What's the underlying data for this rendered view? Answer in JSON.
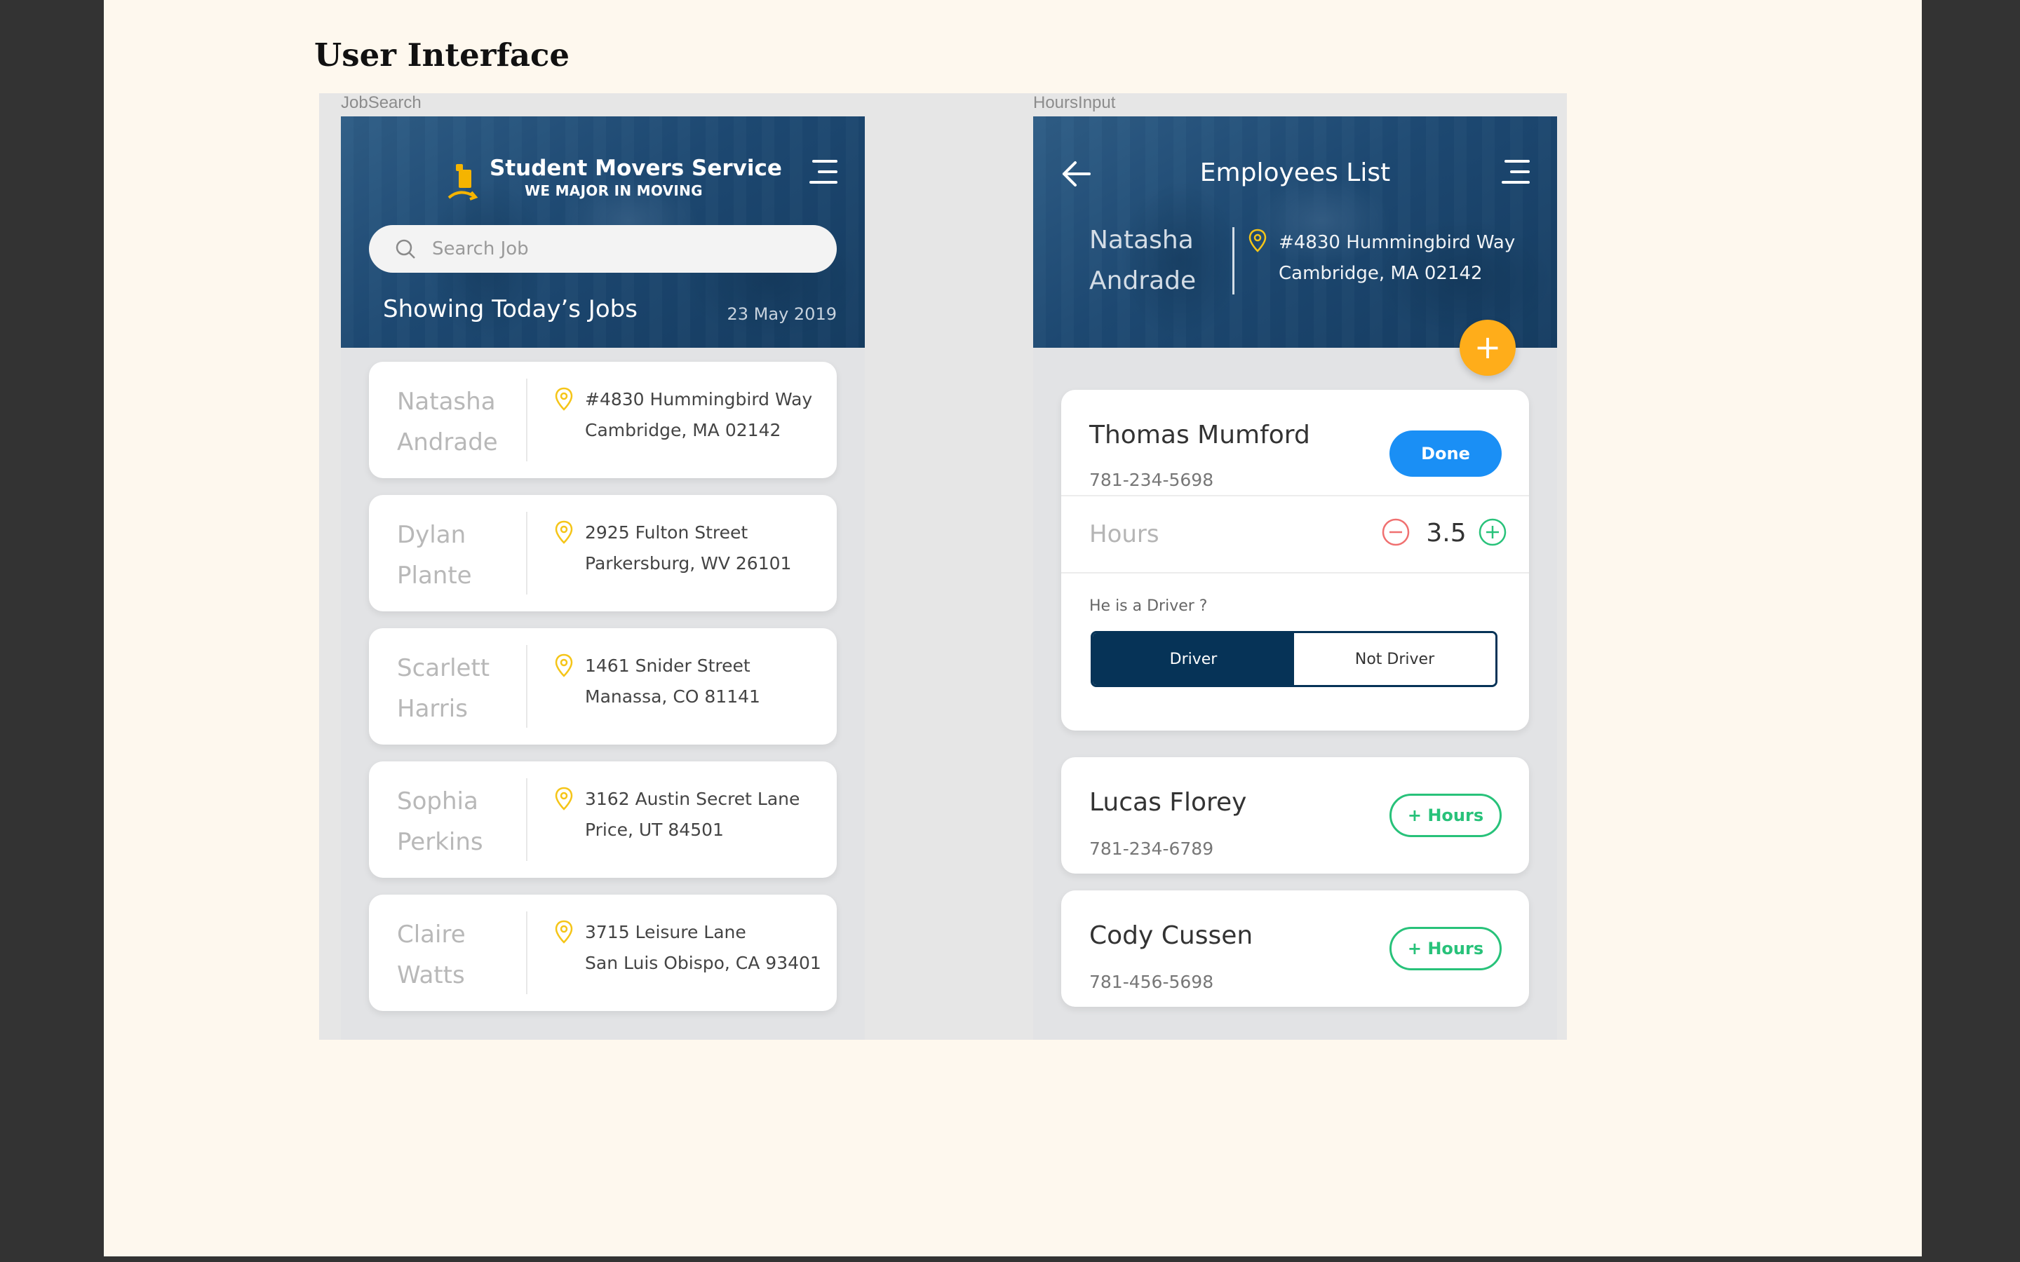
{
  "document": {
    "title": "User Interface"
  },
  "frames": {
    "left_label": "JobSearch",
    "right_label": "HoursInput"
  },
  "job_search": {
    "brand_name": "Student Movers Service",
    "brand_tagline": "WE MAJOR IN MOVING",
    "search_placeholder": "Search Job",
    "showing_label": "Showing Today’s Jobs",
    "date": "23 May 2019",
    "jobs": [
      {
        "first": "Natasha",
        "last": "Andrade",
        "addr1": "#4830 Hummingbird Way",
        "addr2": "Cambridge, MA 02142"
      },
      {
        "first": "Dylan",
        "last": "Plante",
        "addr1": "2925 Fulton Street",
        "addr2": "Parkersburg, WV 26101"
      },
      {
        "first": "Scarlett",
        "last": "Harris",
        "addr1": "1461 Snider Street",
        "addr2": "Manassa, CO 81141"
      },
      {
        "first": "Sophia",
        "last": "Perkins",
        "addr1": "3162 Austin Secret Lane",
        "addr2": "Price, UT 84501"
      },
      {
        "first": "Claire",
        "last": "Watts",
        "addr1": "3715 Leisure Lane",
        "addr2": "San Luis Obispo, CA 93401"
      }
    ]
  },
  "hours_input": {
    "title": "Employees List",
    "client_first": "Natasha",
    "client_last": "Andrade",
    "addr1": "#4830 Hummingbird Way",
    "addr2": "Cambridge, MA 02142",
    "fab_label": "+",
    "active_employee": {
      "name": "Thomas Mumford",
      "phone": "781-234-5698",
      "done_label": "Done",
      "hours_label": "Hours",
      "hours_value": "3.5",
      "driver_question": "He is a Driver ?",
      "driver_label": "Driver",
      "not_driver_label": "Not Driver",
      "driver_selected": true
    },
    "employees": [
      {
        "name": "Lucas Florey",
        "phone": "781-234-6789",
        "button": "+ Hours"
      },
      {
        "name": "Cody Cussen",
        "phone": "781-456-5698",
        "button": "+ Hours"
      }
    ]
  },
  "colors": {
    "primary_blue": "#1a8ff5",
    "navy": "#063357",
    "accent_orange": "#ffad1a",
    "success_green": "#28c27a",
    "pin_yellow": "#f5c518",
    "minus_red": "#f07070"
  },
  "icons": [
    "menu-icon",
    "search-icon",
    "location-pin-icon",
    "back-arrow-icon",
    "minus-circle-icon",
    "plus-circle-icon",
    "add-icon",
    "mover-logo-icon"
  ]
}
